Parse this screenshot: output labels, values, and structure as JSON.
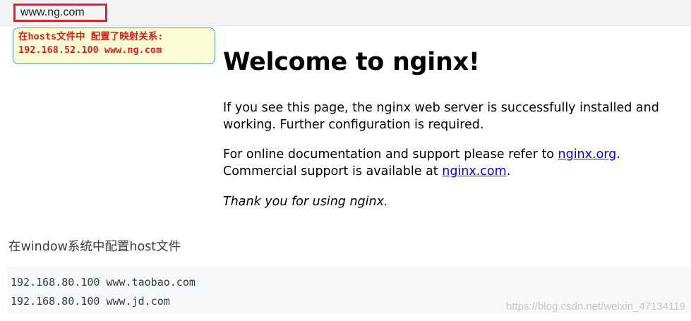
{
  "address_bar": {
    "url": "www.ng.com"
  },
  "note": {
    "line1": "在hosts文件中 配置了映射关系:",
    "line2": "192.168.52.100 www.ng.com"
  },
  "nginx_page": {
    "title": "Welcome to nginx!",
    "para1": "If you see this page, the nginx web server is successfully installed and working. Further configuration is required.",
    "para2_prefix": "For online documentation and support please refer to ",
    "link1": "nginx.org",
    "para2_mid": ".",
    "para2_line2_prefix": "Commercial support is available at ",
    "link2": "nginx.com",
    "para2_suffix": ".",
    "para3": "Thank you for using nginx."
  },
  "blog": {
    "heading": "在window系统中配置host文件",
    "code_lines": [
      "192.168.80.100 www.taobao.com",
      "192.168.80.100 www.jd.com"
    ],
    "watermark": "https://blog.csdn.net/weixin_47134119"
  },
  "colors": {
    "highlight_border": "#d9272e",
    "note_text": "#d71e1e",
    "note_bg": "#fdfdd5",
    "link": "#0000ee"
  }
}
